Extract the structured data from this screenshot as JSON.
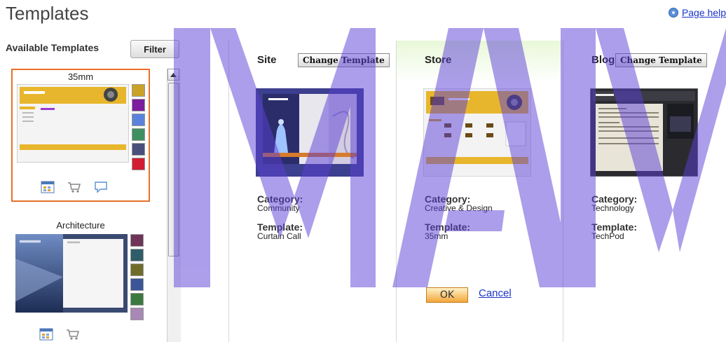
{
  "header": {
    "title": "Templates",
    "help_link": "Page help"
  },
  "sidebar": {
    "label": "Available Templates",
    "filter_label": "Filter",
    "templates": [
      {
        "name": "35mm",
        "selected": true,
        "swatches": [
          "#c9a227",
          "#7c1c9e",
          "#5b82dd",
          "#3f9060",
          "#4a4e7a",
          "#d21d32"
        ],
        "type_icons": [
          "site-icon",
          "store-icon",
          "blog-icon"
        ]
      },
      {
        "name": "Architecture",
        "selected": false,
        "swatches": [
          "#6f3458",
          "#2e5d6a",
          "#6f6c2a",
          "#3a5698",
          "#3b7a3f",
          "#a888b4"
        ],
        "type_icons": [
          "site-icon",
          "store-icon"
        ]
      }
    ]
  },
  "columns": [
    {
      "title": "Site",
      "change_label": "Change Template",
      "category_label": "Category:",
      "category": "Community",
      "template_label": "Template:",
      "template": "Curtain Call"
    },
    {
      "title": "Store",
      "change_label": "",
      "category_label": "Category:",
      "category": "Creative & Design",
      "template_label": "Template:",
      "template": "35mm"
    },
    {
      "title": "Blog",
      "change_label": "Change Template",
      "category_label": "Category:",
      "category": "Technology",
      "template_label": "Template:",
      "template": "TechPod"
    }
  ],
  "actions": {
    "ok_label": "OK",
    "cancel_label": "Cancel"
  },
  "colors": {
    "accent": "#e8702a",
    "link": "#1a33cc",
    "watermark": "#5b3fd6"
  }
}
